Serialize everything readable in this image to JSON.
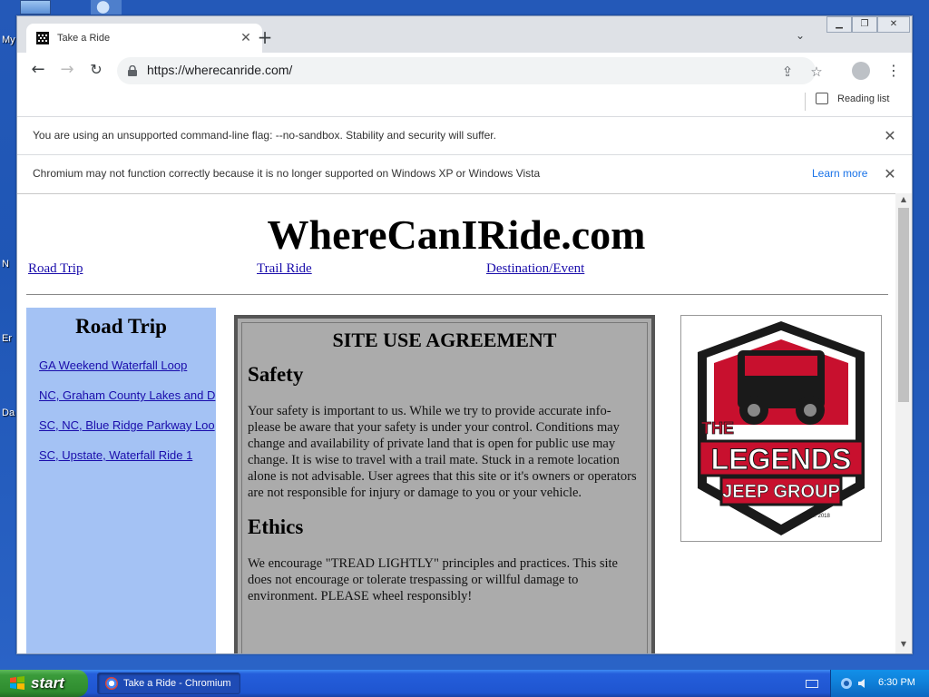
{
  "desktop": {
    "labels": [
      "My",
      "N",
      "Er",
      "Da"
    ]
  },
  "browser": {
    "tab": {
      "title": "Take a Ride"
    },
    "url": "https://wherecanride.com/",
    "reading_list": "Reading list",
    "infobars": [
      {
        "text": "You are using an unsupported command-line flag: --no-sandbox. Stability and security will suffer."
      },
      {
        "text": "Chromium may not function correctly because it is no longer supported on Windows XP or Windows Vista",
        "link": "Learn more"
      }
    ]
  },
  "page": {
    "title": "WhereCanIRide.com",
    "nav": [
      "Road Trip",
      "Trail Ride",
      "Destination/Event"
    ],
    "sidebar": {
      "title": "Road Trip",
      "links": [
        "GA Weekend Waterfall Loop",
        "NC, Graham County Lakes and D",
        "SC, NC, Blue Ridge Parkway Loo",
        "SC, Upstate,  Waterfall Ride 1"
      ]
    },
    "agreement": {
      "title": "SITE USE AGREEMENT",
      "sections": [
        {
          "heading": "Safety",
          "body": "Your safety is important to us. While we try to provide accurate info- please be aware that your safety is under your control. Conditions may change and availability of private land that is open for public use may change. It is wise to travel with a trail mate. Stuck in a remote location alone is not advisable. User agrees that this site or it's owners or operators are not responsible for injury or damage to you or your vehicle."
        },
        {
          "heading": "Ethics",
          "body": "We encourage \"TREAD LIGHTLY\" principles and practices. This site does not encourage or tolerate trespassing or willful damage to environment. PLEASE wheel responsibly!"
        }
      ]
    },
    "logo": {
      "line1": "THE",
      "line2": "LEGENDS",
      "line3": "JEEP GROUP",
      "est": "EST. 2018",
      "colors": {
        "red": "#c8102e",
        "black": "#1a1a1a"
      }
    }
  },
  "taskbar": {
    "start_label": "start",
    "task_title": "Take a Ride - Chromium",
    "clock": "6:30 PM"
  }
}
